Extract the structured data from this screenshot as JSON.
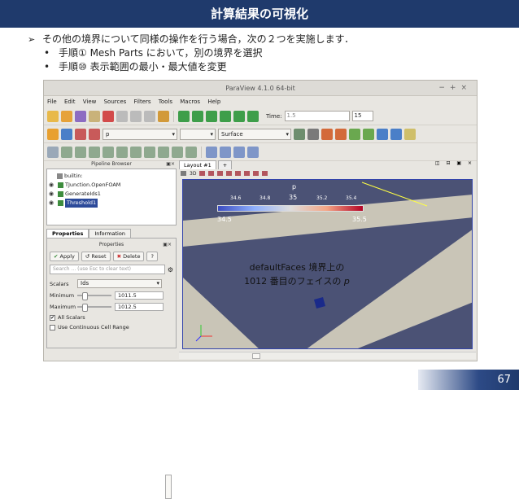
{
  "slide": {
    "title": "計算結果の可視化",
    "bullet_main": "その他の境界について同様の操作を行う場合，次の２つを実施します．",
    "bullet_sub1": "手順① Mesh Parts において，別の境界を選択",
    "bullet_sub2": "手順⑩ 表示範囲の最小・最大値を変更",
    "page_number": "67"
  },
  "window": {
    "title": "ParaView 4.1.0 64-bit",
    "controls": "−+×"
  },
  "menu": [
    "File",
    "Edit",
    "View",
    "Sources",
    "Filters",
    "Tools",
    "Macros",
    "Help"
  ],
  "toolbar1": {
    "time_label": "Time:",
    "time_value": "1.5",
    "time_step": "15"
  },
  "toolbar2": {
    "color_by": "p",
    "component": "",
    "representation": "Surface"
  },
  "pipeline": {
    "title": "Pipeline Browser",
    "items": [
      "builtin:",
      "TJunction.OpenFOAM",
      "GenerateIds1",
      "Threshold1"
    ]
  },
  "properties": {
    "tab_properties": "Properties",
    "tab_information": "Information",
    "section": "Properties",
    "apply": "Apply",
    "reset": "Reset",
    "delete": "Delete",
    "help": "?",
    "search_placeholder": "Search ... (use Esc to clear text)",
    "scalars_label": "Scalars",
    "scalars_value": "Ids",
    "minimum_label": "Minimum",
    "minimum_value": "1011.5",
    "maximum_label": "Maximum",
    "maximum_value": "1012.5",
    "all_scalars": "All Scalars",
    "continuous": "Use Continuous Cell Range"
  },
  "layout": {
    "tab": "Layout #1",
    "plus": "+",
    "view_3d": "3D",
    "colorbar_title": "p",
    "colorbar_ticks": [
      "34.6",
      "34.8",
      "35",
      "35.2",
      "35.4"
    ],
    "colorbar_min": "34.5",
    "colorbar_max": "35.5",
    "colors": [
      "#3b4cc0",
      "#8fb0fe",
      "#dddddd",
      "#f4a585",
      "#b40426"
    ]
  },
  "annotation": {
    "line1": "defaultFaces 境界上の",
    "line2a": "1012 番目のフェイスの ",
    "line2b": "p"
  },
  "colors": {
    "header": "#1f3a6c",
    "view_bg": "#4b5275",
    "surface": "#c9c5b7"
  }
}
